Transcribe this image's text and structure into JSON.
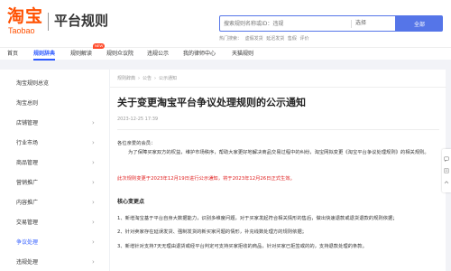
{
  "header": {
    "logo_cn": "淘宝",
    "logo_en": "Taobao",
    "site_title": "平台规则",
    "search_placeholder": "搜索规则名称或ID：违规",
    "search_scope": "选择",
    "search_button": "全部",
    "hot_label": "热门搜索：",
    "hot_terms": [
      "虚假发货",
      "延迟发货",
      "售假",
      "评价"
    ]
  },
  "nav": {
    "items": [
      "首页",
      "规则辞典",
      "规则解读",
      "规则众议院",
      "违规公示",
      "我的律师中心",
      "天猫规则"
    ],
    "active_index": 1,
    "badge": "NEW"
  },
  "sidebar": {
    "items": [
      {
        "label": "淘宝规则总览",
        "chevron": false
      },
      {
        "label": "淘宝总则",
        "chevron": false
      },
      {
        "label": "店铺管理",
        "chevron": true
      },
      {
        "label": "行业市场",
        "chevron": true
      },
      {
        "label": "商品管理",
        "chevron": true
      },
      {
        "label": "营销推广",
        "chevron": true
      },
      {
        "label": "内容推广",
        "chevron": true
      },
      {
        "label": "交易管理",
        "chevron": true
      },
      {
        "label": "争议处理",
        "chevron": true
      },
      {
        "label": "违规处理",
        "chevron": true
      }
    ]
  },
  "article": {
    "breadcrumb": [
      "规则辞典",
      "公告",
      "公示通知"
    ],
    "title": "关于变更淘宝平台争议处理规则的公示通知",
    "date": "2023-12-25 17:39",
    "greeting": "各位亲爱的会员：",
    "body": "为了保障买家双方的权益，维护市场秩序，帮助大家更好地解决商品交易过程中的纠纷，淘宝网拟变更《淘宝平台争议处理规则》的相关规则。",
    "highlight": "此次规则变更于2023年12月19日进行公示通知，将于2023年12月26日正式生效。",
    "section_title": "核心变更点",
    "points": [
      "1、新增淘宝基于平台自身大数据能力，识别多维度问题，对于买家发起符合相关情形的售后，做出快速退款或退货退款的规则依据；",
      "2、针对卖家存在延误发货、强制发货的新买家问题的情形，补充线数处理方的规则依据；",
      "3、新增针对支持7天无理由退货或经平台判定可支持买家拒收的商品，针对买家已拒签或的的，支持退款处理的条款。"
    ]
  },
  "colors": {
    "brand": "#ff5000",
    "accent": "#2f5bff",
    "highlight": "#e02020"
  }
}
